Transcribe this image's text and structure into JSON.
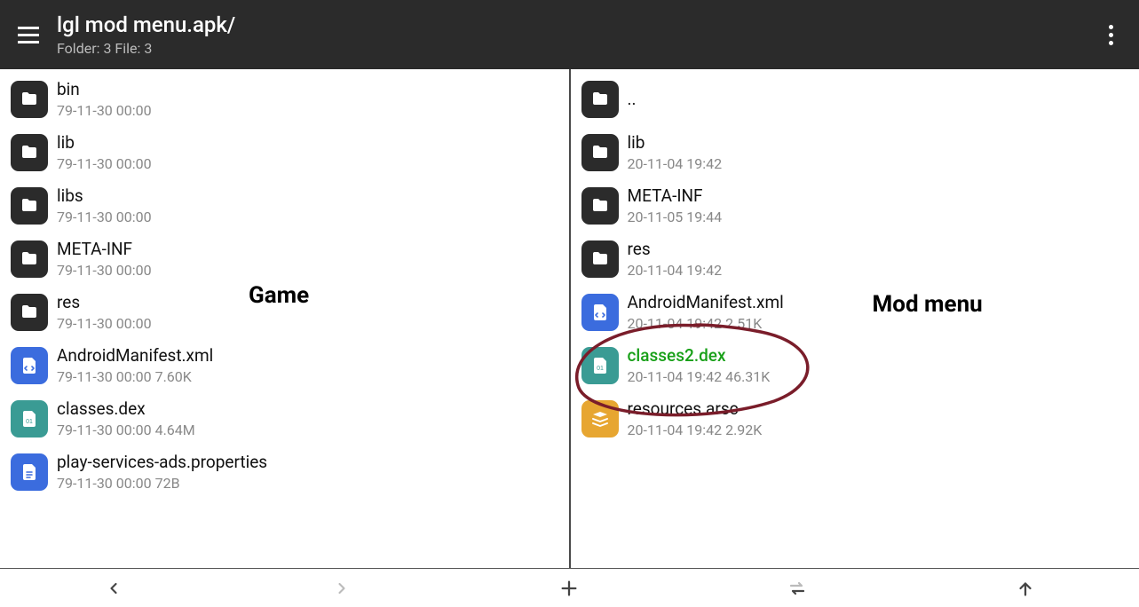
{
  "header": {
    "title": "lgl mod menu.apk/",
    "subtitle": "Folder: 3  File: 3"
  },
  "labels": {
    "left": "Game",
    "right": "Mod menu"
  },
  "leftPane": [
    {
      "name": "bin",
      "meta": "79-11-30 00:00",
      "type": "folder"
    },
    {
      "name": "lib",
      "meta": "79-11-30 00:00",
      "type": "folder"
    },
    {
      "name": "libs",
      "meta": "79-11-30 00:00",
      "type": "folder"
    },
    {
      "name": "META-INF",
      "meta": "79-11-30 00:00",
      "type": "folder"
    },
    {
      "name": "res",
      "meta": "79-11-30 00:00",
      "type": "folder"
    },
    {
      "name": "AndroidManifest.xml",
      "meta": "79-11-30 00:00  7.60K",
      "type": "xml"
    },
    {
      "name": "classes.dex",
      "meta": "79-11-30 00:00  4.64M",
      "type": "dex"
    },
    {
      "name": "play-services-ads.properties",
      "meta": "79-11-30 00:00  72B",
      "type": "doc"
    }
  ],
  "rightPane": [
    {
      "name": "..",
      "meta": "",
      "type": "folder"
    },
    {
      "name": "lib",
      "meta": "20-11-04 19:42",
      "type": "folder"
    },
    {
      "name": "META-INF",
      "meta": "20-11-05 19:44",
      "type": "folder"
    },
    {
      "name": "res",
      "meta": "20-11-04 19:42",
      "type": "folder"
    },
    {
      "name": "AndroidManifest.xml",
      "meta": "20-11-04 19:42  2.51K",
      "type": "xml"
    },
    {
      "name": "classes2.dex",
      "meta": "20-11-04 19:42  46.31K",
      "type": "dex",
      "highlight": true
    },
    {
      "name": "resources.arsc",
      "meta": "20-11-04 19:42  2.92K",
      "type": "arsc"
    }
  ]
}
